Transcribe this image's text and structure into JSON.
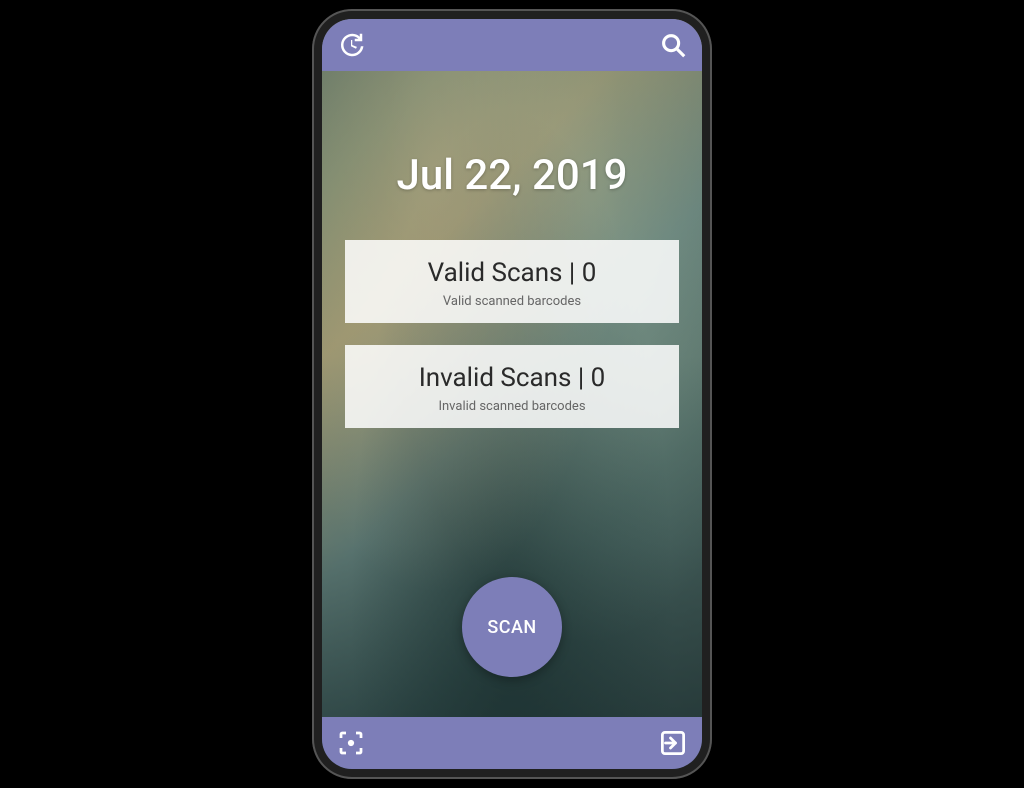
{
  "colors": {
    "accent": "#7d7eb8"
  },
  "date": "Jul 22, 2019",
  "cards": {
    "valid": {
      "title": "Valid Scans | 0",
      "subtitle": "Valid scanned barcodes"
    },
    "invalid": {
      "title": "Invalid Scans | 0",
      "subtitle": "Invalid scanned barcodes"
    }
  },
  "scan_button": "SCAN",
  "icons": {
    "history": "history-icon",
    "search": "search-icon",
    "scan_focus": "focus-icon",
    "exit": "exit-icon"
  }
}
